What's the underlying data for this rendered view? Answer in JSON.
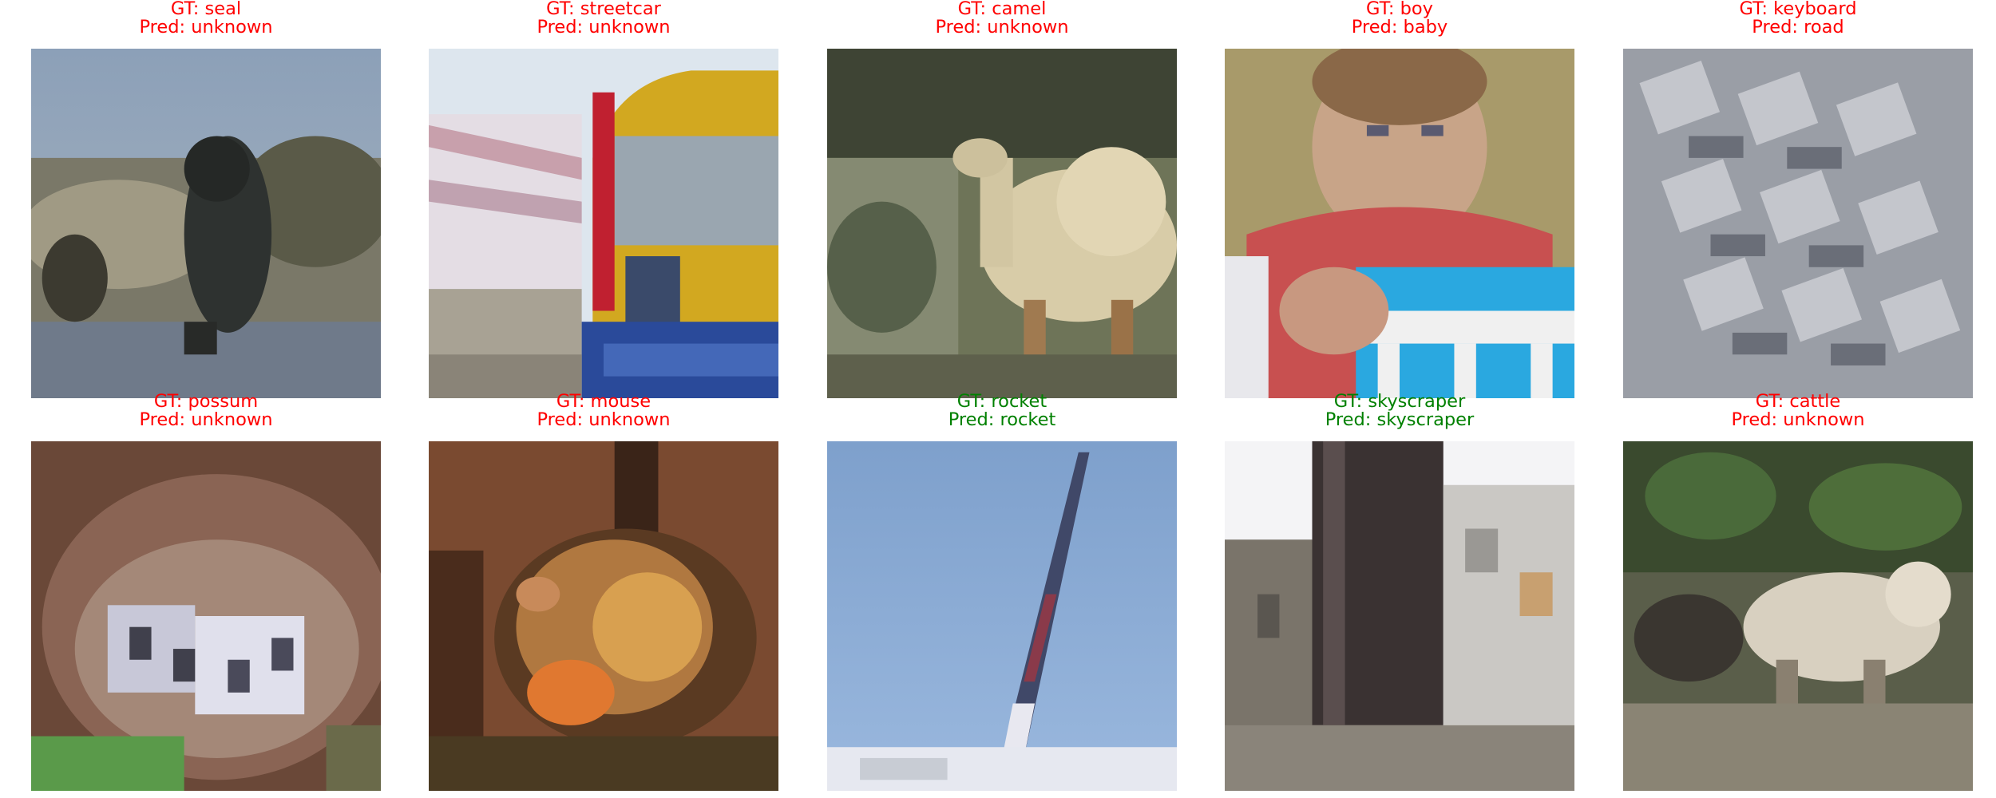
{
  "colors": {
    "correct": "#008000",
    "incorrect": "#ff0000"
  },
  "samples": [
    {
      "gt": "GT: seal",
      "pred": "Pred: unknown",
      "correct": false
    },
    {
      "gt": "GT: streetcar",
      "pred": "Pred: unknown",
      "correct": false
    },
    {
      "gt": "GT: camel",
      "pred": "Pred: unknown",
      "correct": false
    },
    {
      "gt": "GT: boy",
      "pred": "Pred: baby",
      "correct": false
    },
    {
      "gt": "GT: keyboard",
      "pred": "Pred: road",
      "correct": false
    },
    {
      "gt": "GT: possum",
      "pred": "Pred: unknown",
      "correct": false
    },
    {
      "gt": "GT: mouse",
      "pred": "Pred: unknown",
      "correct": false
    },
    {
      "gt": "GT: rocket",
      "pred": "Pred: rocket",
      "correct": true
    },
    {
      "gt": "GT: skyscraper",
      "pred": "Pred: skyscraper",
      "correct": true
    },
    {
      "gt": "GT: cattle",
      "pred": "Pred: unknown",
      "correct": false
    }
  ]
}
